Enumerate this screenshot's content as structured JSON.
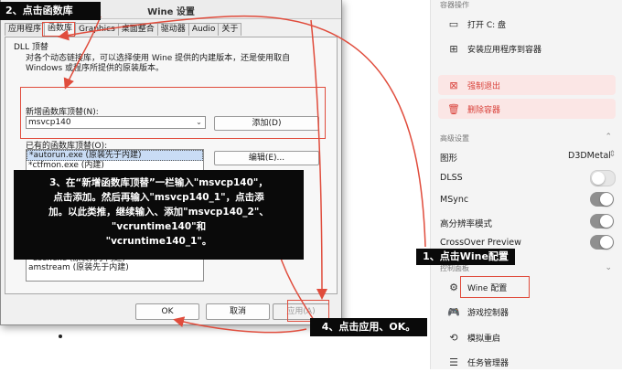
{
  "dialog": {
    "title": "Wine 设置",
    "tabs": [
      "应用程序",
      "函数库",
      "Graphics",
      "桌面整合",
      "驱动器",
      "Audio",
      "关于"
    ],
    "active_tab": "函数库",
    "group_label": "DLL 顶替",
    "description": "对各个动态链接库，可以选择使用 Wine 提供的内建版本，还是使用取自 Windows 或程序所提供的原装版本。",
    "new_override_label": "新增函数库顶替(N):",
    "new_override_value": "msvcp140",
    "add_button": "添加(D)",
    "existing_label": "已有的函数库顶替(O):",
    "existing_items": [
      "*autorun.exe (原装先于内建)",
      "*ctfmon.exe (内建)"
    ],
    "existing_items_tail": [
      "*user.exe (原装先于内建)",
      "amstream (原装先于内建)"
    ],
    "edit_button": "编辑(E)...",
    "ok_button": "OK",
    "cancel_button": "取消",
    "apply_button": "应用(A)"
  },
  "annotations": {
    "step1": "1、点击Wine配置",
    "step2": "2、点击函数库",
    "step3_lines": [
      "3、在“新增函数库顶替”一栏输入\"msvcp140\"，",
      "点击添加。然后再输入\"msvcp140_1\"，点击添",
      "加。以此类推，继续输入、添加\"msvcp140_2\"、",
      "\"vcruntime140\"和",
      "\"vcruntime140_1\"。"
    ],
    "step4": "4、点击应用、OK。",
    "highlight_color": "#e04c3c"
  },
  "panel": {
    "section_top": "容器操作",
    "open_c": "打开 C: 盘",
    "install_app": "安装应用程序到容器",
    "force_quit": "强制退出",
    "delete_container": "删除容器",
    "advanced": "高级设置",
    "graphics_label": "图形",
    "graphics_value": "D3DMetal",
    "dlss": "DLSS",
    "msync": "MSync",
    "hires": "高分辨率模式",
    "crossover_preview": "CrossOver Preview",
    "control_panel": "控制面板",
    "wine_config": "Wine 配置",
    "game_controller": "游戏控制器",
    "simulate_reboot": "模拟重启",
    "task_manager": "任务管理器",
    "toggles": {
      "dlss": false,
      "msync": true,
      "hires": true,
      "crossover_preview": true
    }
  }
}
